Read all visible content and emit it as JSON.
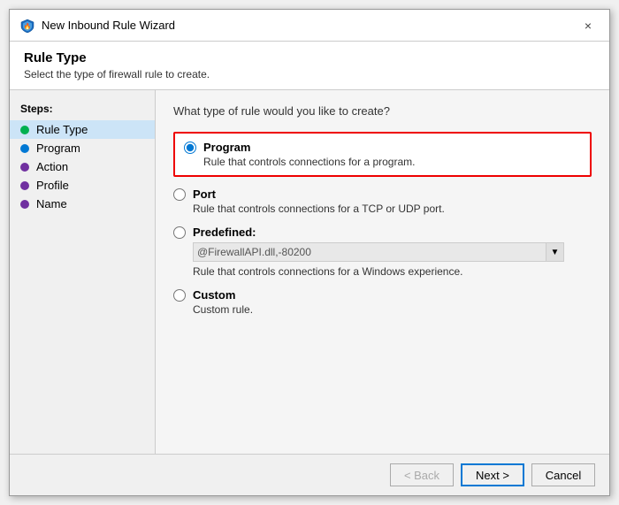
{
  "dialog": {
    "title": "New Inbound Rule Wizard",
    "close_label": "×"
  },
  "header": {
    "title": "Rule Type",
    "subtitle": "Select the type of firewall rule to create."
  },
  "sidebar": {
    "steps_label": "Steps:",
    "items": [
      {
        "id": "rule-type",
        "label": "Rule Type",
        "dot": "green",
        "active": true
      },
      {
        "id": "program",
        "label": "Program",
        "dot": "blue",
        "active": false
      },
      {
        "id": "action",
        "label": "Action",
        "dot": "purple",
        "active": false
      },
      {
        "id": "profile",
        "label": "Profile",
        "dot": "purple",
        "active": false
      },
      {
        "id": "name",
        "label": "Name",
        "dot": "purple",
        "active": false
      }
    ]
  },
  "main": {
    "question": "What type of rule would you like to create?",
    "options": [
      {
        "id": "program",
        "label": "Program",
        "desc": "Rule that controls connections for a program.",
        "checked": true,
        "highlighted": true
      },
      {
        "id": "port",
        "label": "Port",
        "desc": "Rule that controls connections for a TCP or UDP port.",
        "checked": false,
        "highlighted": false
      },
      {
        "id": "predefined",
        "label": "Predefined:",
        "desc": "Rule that controls connections for a Windows experience.",
        "checked": false,
        "highlighted": false,
        "dropdown_value": "@FirewallAPI.dll,-80200"
      },
      {
        "id": "custom",
        "label": "Custom",
        "desc": "Custom rule.",
        "checked": false,
        "highlighted": false
      }
    ]
  },
  "footer": {
    "back_label": "< Back",
    "next_label": "Next >",
    "cancel_label": "Cancel"
  }
}
